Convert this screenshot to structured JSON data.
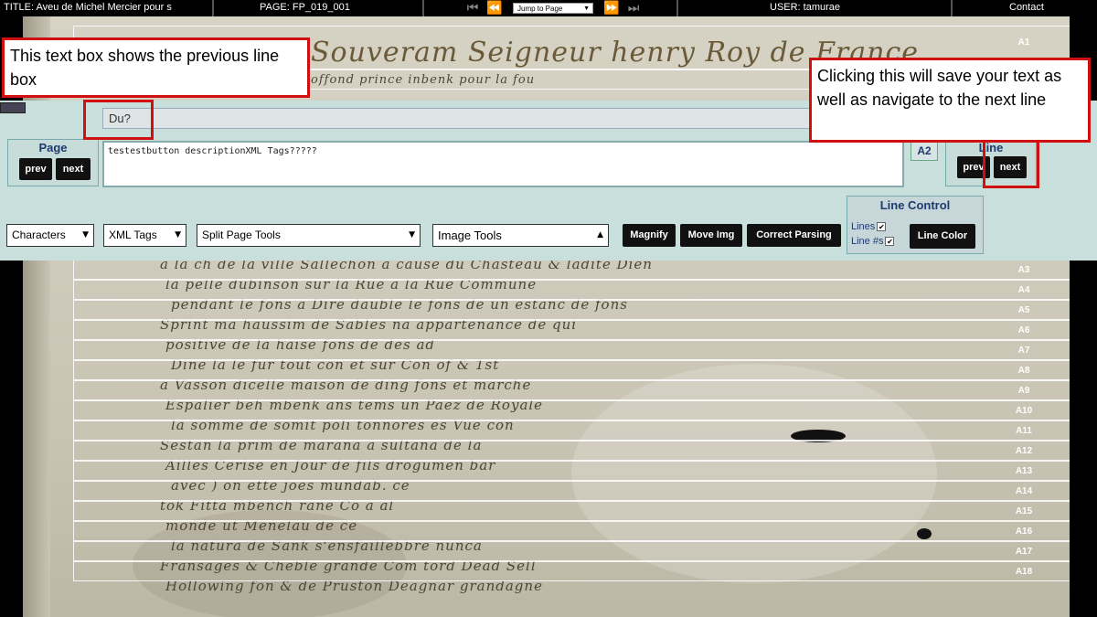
{
  "topbar": {
    "title": "TITLE: Aveu de Michel Mercier pour s",
    "page": "PAGE:  FP_019_001",
    "jump_label": "Jump to Page",
    "user": "USER:  tamurae",
    "contact": "Contact"
  },
  "icons": {
    "first": "skip-first-icon",
    "prev": "previous-icon",
    "next": "next-icon",
    "last": "skip-last-icon"
  },
  "manuscript": {
    "top_line_text": "Souveram Seigneur henry Roy de France",
    "second_line_text": "offond prince inbenk pour la fou"
  },
  "line_labels": [
    "A1",
    "A3",
    "A4",
    "A5",
    "A6",
    "A7",
    "A8",
    "A9",
    "A10",
    "A11",
    "A12",
    "A13",
    "A14",
    "A15",
    "A16",
    "A17",
    "A18"
  ],
  "handwriting_lines": [
    "a la ch de la ville Sallechon a cause du Chasteau & ladite Dien",
    "la pelle dubinson sur la Rue a la Rue Commune",
    "pendant le fons a Dire dauble le fons de un estanc de fons",
    "Sprint ma haussim de Sables na appartenance de qui",
    "positive de la haise fons de des ad",
    "Dine la le fur tout con et sur Con of & 1st",
    "a Vasson dicelle maison de ding fons et marche",
    "Espalier beh mbenk ans tems un Paez de Royale",
    "la somme de somit poli tonnores es Vue con",
    "Sestan la prim de marana a sultana de la",
    "Ailles Cerise en Jour de fils drogumen bar",
    "avec ) on ette joes mundab. ce",
    "tok Fitta mbench rane Co a al",
    "monde ut Menelau de ce",
    "la natura de Sank s'ensfaillebbre nunca",
    "Fransages & Cheble grande Com tord Dead Sell",
    "Hollowing fon & de Pruston Deagnar grandagne"
  ],
  "panel": {
    "previous_line_text": "Du?",
    "current_text": "testestbutton descriptionXML Tags?????",
    "page_group": {
      "title": "Page",
      "prev": "prev",
      "next": "next"
    },
    "a2_label": "A2",
    "line_group": {
      "title": "Line",
      "prev": "prev",
      "next": "next"
    },
    "selects": {
      "characters": "Characters",
      "xml_tags": "XML Tags",
      "split_page": "Split Page Tools",
      "image_tools": "Image Tools"
    },
    "buttons": {
      "magnify": "Magnify",
      "move_img": "Move Img",
      "correct_parsing": "Correct Parsing",
      "line_color": "Line Color"
    },
    "line_control": {
      "title": "Line Control",
      "lines_label": "Lines",
      "line_nums_label": "Line #s",
      "lines_checked": true,
      "line_nums_checked": true
    }
  },
  "callouts": {
    "previous_line": "This text box shows the previous line box",
    "next_line": "Clicking this will save your text as well as navigate to the next line"
  },
  "colors": {
    "panel_bg": "#c9dfdb",
    "callout_border": "#d01010",
    "heading_blue": "#1d3b6e"
  }
}
